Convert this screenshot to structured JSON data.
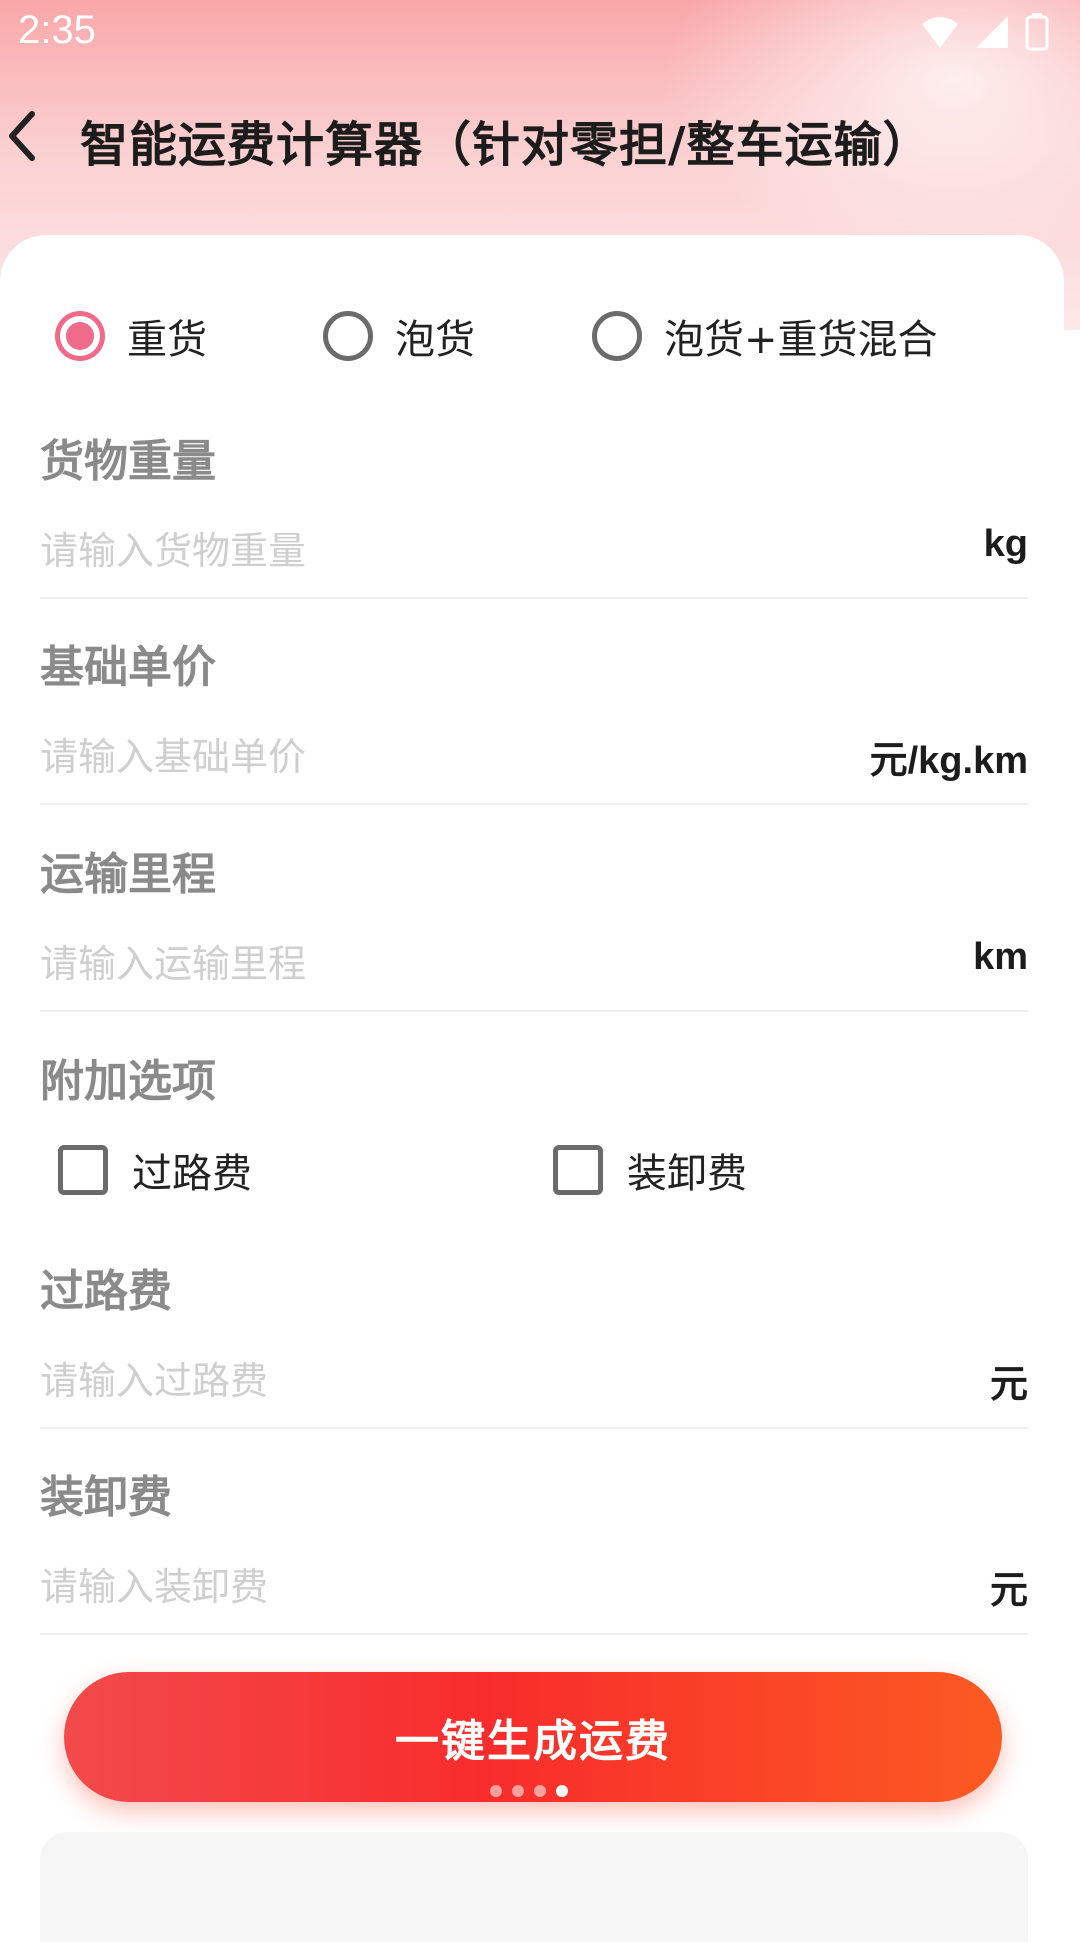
{
  "status_bar": {
    "time": "2:35"
  },
  "header": {
    "title": "智能运费计算器（针对零担/整车运输）"
  },
  "cargo_type": {
    "options": [
      {
        "label": "重货",
        "checked": true
      },
      {
        "label": "泡货",
        "checked": false
      },
      {
        "label": "泡货+重货混合",
        "checked": false
      }
    ]
  },
  "fields": {
    "weight": {
      "label": "货物重量",
      "placeholder": "请输入货物重量",
      "unit": "kg"
    },
    "unit_price": {
      "label": "基础单价",
      "placeholder": "请输入基础单价",
      "unit": "元/kg.km"
    },
    "distance": {
      "label": "运输里程",
      "placeholder": "请输入运输里程",
      "unit": "km"
    },
    "toll": {
      "label": "过路费",
      "placeholder": "请输入过路费",
      "unit": "元"
    },
    "handling": {
      "label": "装卸费",
      "placeholder": "请输入装卸费",
      "unit": "元"
    }
  },
  "extras": {
    "label": "附加选项",
    "options": [
      {
        "label": "过路费",
        "checked": false
      },
      {
        "label": "装卸费",
        "checked": false
      }
    ]
  },
  "actions": {
    "generate_label": "一键生成运费"
  },
  "pager": {
    "count": 4,
    "active_index": 3
  },
  "colors": {
    "accent": "#f06a8c",
    "button_start": "#f24a4c",
    "button_end": "#fb5a22"
  }
}
